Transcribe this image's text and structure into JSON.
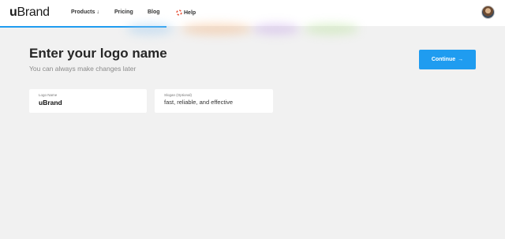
{
  "header": {
    "logo_u": "u",
    "logo_brand": "Brand",
    "nav": {
      "products": "Products",
      "products_caret": "↓",
      "pricing": "Pricing",
      "blog": "Blog",
      "help": "Help"
    },
    "progress_fraction": 0.33
  },
  "main": {
    "title": "Enter your logo name",
    "subtitle": "You can always make changes later",
    "continue_label": "Continue",
    "continue_arrow": "→"
  },
  "form": {
    "logo_name": {
      "label": "Logo Name",
      "value": "uBrand"
    },
    "slogan": {
      "label": "Slogan (Optional)",
      "value": "fast, reliable, and effective"
    }
  },
  "colors": {
    "accent": "#1f9cf0",
    "background": "#f1f1f1",
    "help_icon": "#e8553d"
  },
  "icons": {
    "help": "lifebuoy-icon",
    "continue": "arrow-right-icon",
    "avatar": "user-avatar"
  }
}
